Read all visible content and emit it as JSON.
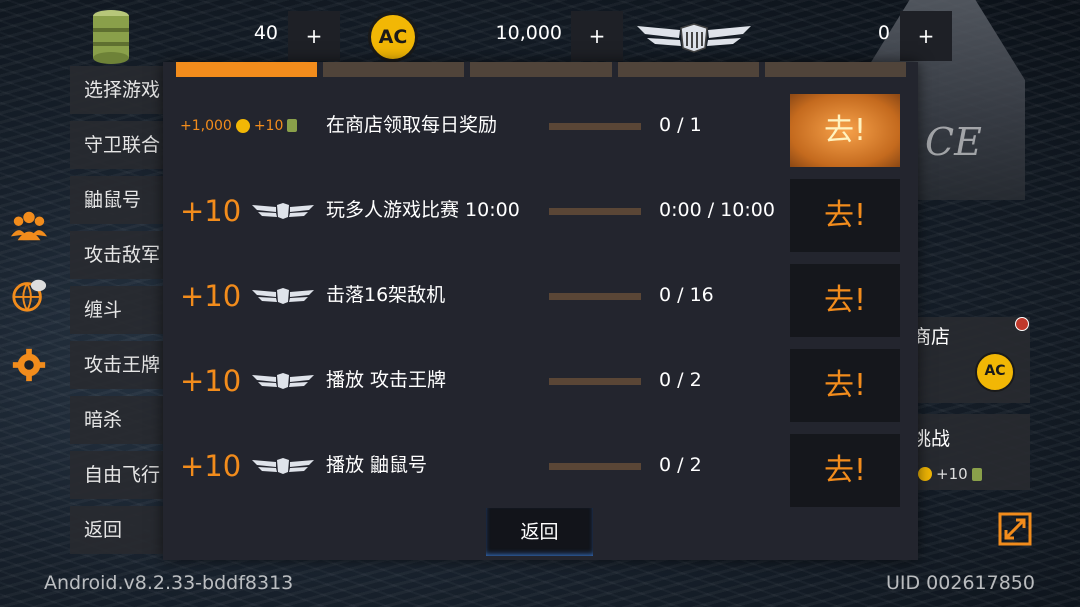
{
  "top_bar": {
    "fuel_value": "40",
    "coin_value": "10,000",
    "medal_value": "0",
    "plus_label": "+",
    "coin_label": "AC"
  },
  "left_menu": [
    {
      "label": "选择游戏"
    },
    {
      "label": "守卫联合"
    },
    {
      "label": "鼬鼠号"
    },
    {
      "label": "攻击敌军"
    },
    {
      "label": "缠斗"
    },
    {
      "label": "攻击王牌"
    },
    {
      "label": "暗杀"
    },
    {
      "label": "自由飞行"
    },
    {
      "label": "返回"
    }
  ],
  "background_right": {
    "shop_label": "商店",
    "challenge_label": "挑战",
    "challenge_reward": "+10",
    "ship_text": "CE"
  },
  "dialog": {
    "progress_segments": [
      1,
      0,
      0,
      0,
      0
    ],
    "tasks": [
      {
        "reward_coin": "+1,000",
        "reward_fuel": "+10",
        "reward_medal": "",
        "task": "在商店领取每日奖励",
        "progress_text": "0 / 1",
        "progress": 0,
        "go_label": "去!",
        "highlight": true
      },
      {
        "reward_coin": "",
        "reward_fuel": "",
        "reward_medal": "+10",
        "task": "玩多人游戏比赛 10:00",
        "progress_text": "0:00 / 10:00",
        "progress": 0,
        "go_label": "去!",
        "highlight": false
      },
      {
        "reward_coin": "",
        "reward_fuel": "",
        "reward_medal": "+10",
        "task": "击落16架敌机",
        "progress_text": "0 / 16",
        "progress": 0,
        "go_label": "去!",
        "highlight": false
      },
      {
        "reward_coin": "",
        "reward_fuel": "",
        "reward_medal": "+10",
        "task": "播放 攻击王牌",
        "progress_text": "0 / 2",
        "progress": 0,
        "go_label": "去!",
        "highlight": false
      },
      {
        "reward_coin": "",
        "reward_fuel": "",
        "reward_medal": "+10",
        "task": "播放 鼬鼠号",
        "progress_text": "0 / 2",
        "progress": 0,
        "go_label": "去!",
        "highlight": false
      }
    ],
    "back_label": "返回"
  },
  "footer": {
    "version": "Android.v8.2.33-bddf8313",
    "uid": "UID 002617850"
  },
  "colors": {
    "accent": "#f28c1c",
    "panel": "#23252e",
    "coin": "#f2b705"
  }
}
